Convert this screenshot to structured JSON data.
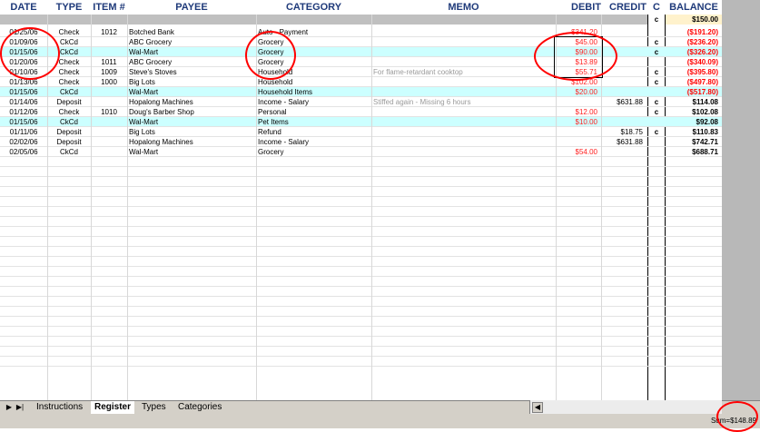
{
  "columns": {
    "date": "DATE",
    "type": "TYPE",
    "item": "ITEM #",
    "payee": "PAYEE",
    "category": "CATEGORY",
    "memo": "MEMO",
    "debit": "DEBIT",
    "credit": "CREDIT",
    "c": "C",
    "balance": "BALANCE"
  },
  "opening": {
    "c": "c",
    "balance": "$150.00"
  },
  "rows": [
    {
      "date": "01/25/06",
      "type": "Check",
      "item": "1012",
      "payee": "Botched Bank",
      "category": "Auto - Payment",
      "memo": "",
      "debit": "$341.20",
      "credit": "",
      "c": "",
      "balance": "($191.20)",
      "highlight": false
    },
    {
      "date": "01/09/06",
      "type": "CkCd",
      "item": "",
      "payee": "ABC Grocery",
      "category": "Grocery",
      "memo": "",
      "debit": "$45.00",
      "credit": "",
      "c": "c",
      "balance": "($236.20)",
      "highlight": false
    },
    {
      "date": "01/15/06",
      "type": "CkCd",
      "item": "",
      "payee": "Wal-Mart",
      "category": "Grocery",
      "memo": "",
      "debit": "$90.00",
      "credit": "",
      "c": "c",
      "balance": "($326.20)",
      "highlight": true
    },
    {
      "date": "01/20/06",
      "type": "Check",
      "item": "1011",
      "payee": "ABC Grocery",
      "category": "Grocery",
      "memo": "",
      "debit": "$13.89",
      "credit": "",
      "c": "",
      "balance": "($340.09)",
      "highlight": false
    },
    {
      "date": "01/10/06",
      "type": "Check",
      "item": "1009",
      "payee": "Steve's Stoves",
      "category": "Household",
      "memo": "For flame-retardant cooktop",
      "debit": "$55.71",
      "credit": "",
      "c": "c",
      "balance": "($395.80)",
      "highlight": false
    },
    {
      "date": "01/13/06",
      "type": "Check",
      "item": "1000",
      "payee": "Big Lots",
      "category": "Household",
      "memo": "",
      "debit": "$102.00",
      "credit": "",
      "c": "c",
      "balance": "($497.80)",
      "highlight": false
    },
    {
      "date": "01/15/06",
      "type": "CkCd",
      "item": "",
      "payee": "Wal-Mart",
      "category": "Household Items",
      "memo": "",
      "debit": "$20.00",
      "credit": "",
      "c": "",
      "balance": "($517.80)",
      "highlight": true
    },
    {
      "date": "01/14/06",
      "type": "Deposit",
      "item": "",
      "payee": "Hopalong Machines",
      "category": "Income - Salary",
      "memo": "Stiffed again - Missing 6 hours",
      "debit": "",
      "credit": "$631.88",
      "c": "c",
      "balance": "$114.08",
      "highlight": false
    },
    {
      "date": "01/12/06",
      "type": "Check",
      "item": "1010",
      "payee": "Doug's Barber Shop",
      "category": "Personal",
      "memo": "",
      "debit": "$12.00",
      "credit": "",
      "c": "c",
      "balance": "$102.08",
      "highlight": false
    },
    {
      "date": "01/15/06",
      "type": "CkCd",
      "item": "",
      "payee": "Wal-Mart",
      "category": "Pet Items",
      "memo": "",
      "debit": "$10.00",
      "credit": "",
      "c": "",
      "balance": "$92.08",
      "highlight": true
    },
    {
      "date": "01/11/06",
      "type": "Deposit",
      "item": "",
      "payee": "Big Lots",
      "category": "Refund",
      "memo": "",
      "debit": "",
      "credit": "$18.75",
      "c": "c",
      "balance": "$110.83",
      "highlight": false
    },
    {
      "date": "02/02/06",
      "type": "Deposit",
      "item": "",
      "payee": "Hopalong Machines",
      "category": "Income - Salary",
      "memo": "",
      "debit": "",
      "credit": "$631.88",
      "c": "",
      "balance": "$742.71",
      "highlight": false
    },
    {
      "date": "02/05/06",
      "type": "CkCd",
      "item": "",
      "payee": "Wal-Mart",
      "category": "Grocery",
      "memo": "",
      "debit": "$54.00",
      "credit": "",
      "c": "",
      "balance": "$688.71",
      "highlight": false
    }
  ],
  "empty_rows": 21,
  "tabs": [
    {
      "label": "Instructions",
      "active": false
    },
    {
      "label": "Register",
      "active": true
    },
    {
      "label": "Types",
      "active": false
    },
    {
      "label": "Categories",
      "active": false
    }
  ],
  "status": {
    "sum": "Sum=$148.89"
  },
  "colors": {
    "highlight": "#ccffff",
    "negative": "#ff0000",
    "header_text": "#1f3a7a",
    "annotation": "#ff0000"
  }
}
